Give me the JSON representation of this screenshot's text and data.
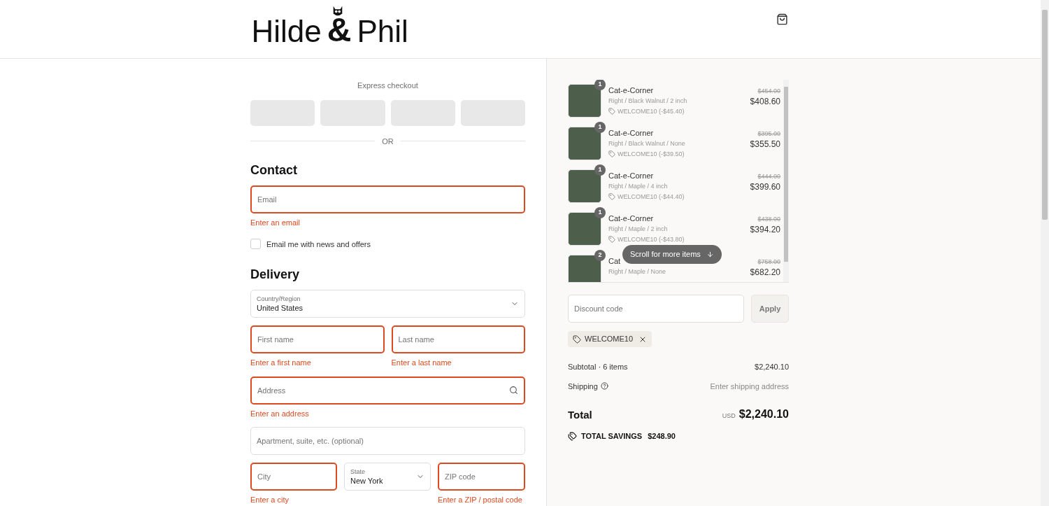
{
  "header": {
    "logo": {
      "first": "Hilde",
      "amp": "&",
      "second": "Phil"
    }
  },
  "express_checkout": {
    "label": "Express checkout",
    "separator": "OR"
  },
  "contact": {
    "heading": "Contact",
    "email": {
      "placeholder": "Email",
      "invalid": true,
      "error": "Enter an email"
    },
    "newsletter": {
      "label": "Email me with news and offers",
      "checked": false
    }
  },
  "delivery": {
    "heading": "Delivery",
    "rows": [
      [
        {
          "kind": "select",
          "label": "Country/Region",
          "value": "United States",
          "invalid": false
        }
      ],
      [
        {
          "kind": "text",
          "placeholder": "First name",
          "invalid": true,
          "error": "Enter a first name"
        },
        {
          "kind": "text",
          "placeholder": "Last name",
          "invalid": true,
          "error": "Enter a last name"
        }
      ],
      [
        {
          "kind": "search",
          "placeholder": "Address",
          "invalid": true,
          "error": "Enter an address"
        }
      ],
      [
        {
          "kind": "text",
          "placeholder": "Apartment, suite, etc. (optional)",
          "invalid": false
        }
      ],
      [
        {
          "kind": "text",
          "placeholder": "City",
          "invalid": true,
          "error": "Enter a city"
        },
        {
          "kind": "select",
          "label": "State",
          "value": "New York",
          "invalid": false
        },
        {
          "kind": "text",
          "placeholder": "ZIP code",
          "invalid": true,
          "error": "Enter a ZIP / postal code"
        }
      ]
    ]
  },
  "order_items": [
    {
      "quantity": "1",
      "name": "Cat-e-Corner",
      "variant": "Right / Black Walnut / 2 inch",
      "discount": "WELCOME10 (-$45.40)",
      "original_price": "$454.00",
      "price": "$408.60"
    },
    {
      "quantity": "1",
      "name": "Cat-e-Corner",
      "variant": "Right / Black Walnut / None",
      "discount": "WELCOME10 (-$39.50)",
      "original_price": "$395.00",
      "price": "$355.50"
    },
    {
      "quantity": "1",
      "name": "Cat-e-Corner",
      "variant": "Right / Maple / 4 inch",
      "discount": "WELCOME10 (-$44.40)",
      "original_price": "$444.00",
      "price": "$399.60"
    },
    {
      "quantity": "1",
      "name": "Cat-e-Corner",
      "variant": "Right / Maple / 2 inch",
      "discount": "WELCOME10 (-$43.80)",
      "original_price": "$438.00",
      "price": "$394.20"
    },
    {
      "quantity": "2",
      "name": "Cat",
      "variant": "Right / Maple / None",
      "original_price": "$758.00",
      "price": "$682.20"
    }
  ],
  "scroll_hint": "Scroll for more items",
  "discount": {
    "placeholder": "Discount code",
    "button": "Apply",
    "applied_code": "WELCOME10"
  },
  "summary": {
    "subtotal_label": "Subtotal · 6 items",
    "subtotal": "$2,240.10",
    "shipping_label": "Shipping",
    "shipping": "Enter shipping address",
    "total_label": "Total",
    "currency": "USD",
    "total": "$2,240.10",
    "savings_label": "TOTAL SAVINGS",
    "savings": "$248.90"
  }
}
